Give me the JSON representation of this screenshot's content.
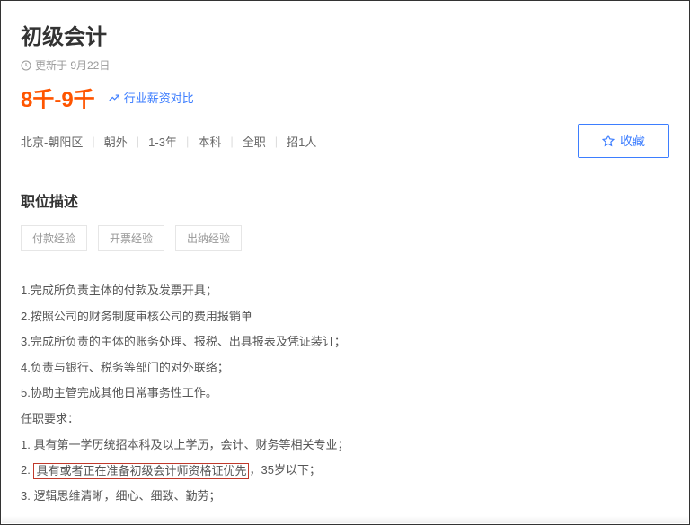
{
  "header": {
    "title": "初级会计",
    "updated_label": "更新于 9月22日",
    "salary": "8千-9千",
    "salary_compare": "行业薪资对比"
  },
  "meta": {
    "location": "北京-朝阳区",
    "area": "朝外",
    "experience": "1-3年",
    "education": "本科",
    "jobtype": "全职",
    "headcount": "招1人"
  },
  "fav_btn": "收藏",
  "desc": {
    "heading": "职位描述",
    "tags": [
      "付款经验",
      "开票经验",
      "出纳经验"
    ],
    "lines": {
      "l1": "1.完成所负责主体的付款及发票开具；",
      "l2": "2.按照公司的财务制度审核公司的费用报销单",
      "l3": "3.完成所负责的主体的账务处理、报税、出具报表及凭证装订；",
      "l4": "4.负责与银行、税务等部门的对外联络；",
      "l5": "5.协助主管完成其他日常事务性工作。",
      "req_heading": "任职要求：",
      "r1": "1. 具有第一学历统招本科及以上学历，会计、财务等相关专业；",
      "r2_prefix": "2. ",
      "r2_highlight": "具有或者正在准备初级会计师资格证优先",
      "r2_suffix": "，35岁以下；",
      "r3": "3. 逻辑思维清晰，细心、细致、勤劳；"
    }
  }
}
